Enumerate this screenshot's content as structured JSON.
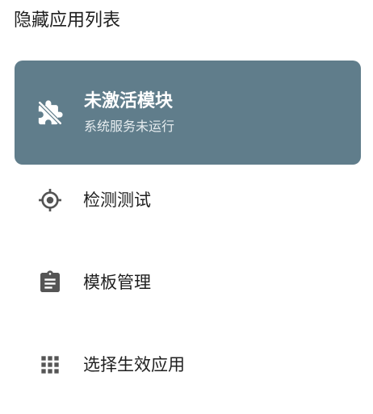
{
  "page": {
    "title": "隐藏应用列表"
  },
  "status_card": {
    "title": "未激活模块",
    "subtitle": "系统服务未运行",
    "background": "#607d8b",
    "icon": "extension-off-icon"
  },
  "menu": {
    "items": [
      {
        "label": "检测测试",
        "icon": "target-icon"
      },
      {
        "label": "模板管理",
        "icon": "clipboard-icon"
      },
      {
        "label": "选择生效应用",
        "icon": "apps-grid-icon"
      }
    ]
  },
  "colors": {
    "icon": "#555555",
    "text": "#1f1f1f"
  }
}
